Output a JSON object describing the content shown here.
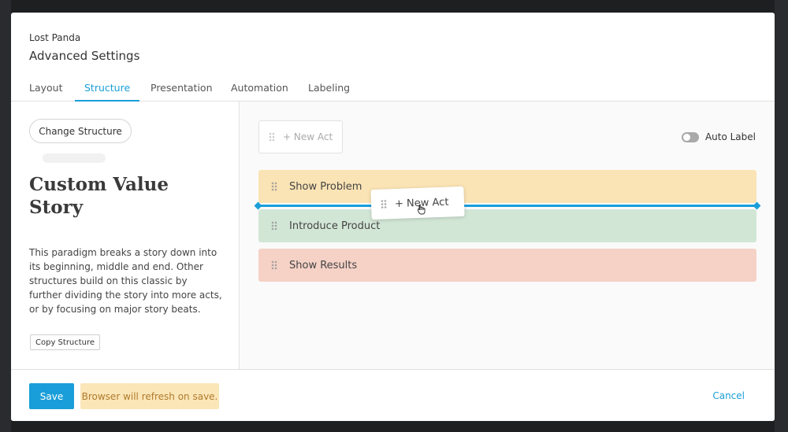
{
  "modal": {
    "project_name": "Lost Panda",
    "title": "Advanced Settings"
  },
  "tabs": [
    {
      "label": "Layout",
      "active": false
    },
    {
      "label": "Structure",
      "active": true
    },
    {
      "label": "Presentation",
      "active": false
    },
    {
      "label": "Automation",
      "active": false
    },
    {
      "label": "Labeling",
      "active": false
    }
  ],
  "left_panel": {
    "change_structure_label": "Change Structure",
    "structure_title": "Custom Value Story",
    "description": "This paradigm breaks a story down into its beginning, middle and end. Other structures build on this classic by further dividing the story into more acts, or by focusing on major story beats.",
    "copy_label": "Copy Structure"
  },
  "right_panel": {
    "new_act_label": "+ New Act",
    "auto_label": "Auto Label",
    "auto_label_on": false,
    "acts": [
      {
        "label": "Show Problem",
        "color": "#fae3b4"
      },
      {
        "label": "Introduce Product",
        "color": "#d2e6d6"
      },
      {
        "label": "Show Results",
        "color": "#f5d1c6"
      }
    ],
    "dragged_label": "+ New Act",
    "drop_indicator_color": "#1a9ed9"
  },
  "footer": {
    "save_label": "Save",
    "notice": "Browser will refresh on save.",
    "cancel_label": "Cancel"
  }
}
